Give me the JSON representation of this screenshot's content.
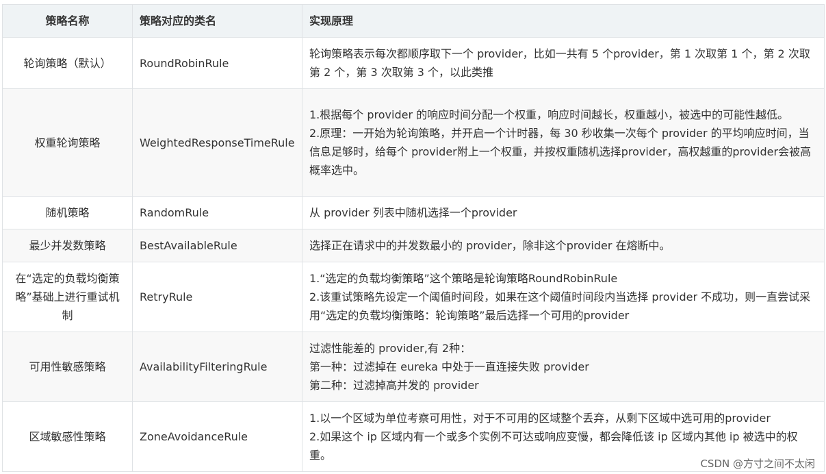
{
  "headers": [
    "策略名称",
    "策略对应的类名",
    "实现原理"
  ],
  "rows": [
    {
      "name": [
        "轮询策略（默认）"
      ],
      "class": "RoundRobinRule",
      "desc": [
        "轮询策略表示每次都顺序取下一个 provider，比如一共有 5 个provider，第 1 次取第 1 个，第 2 次取第 2 个，第 3 次取第 3 个，以此类推"
      ]
    },
    {
      "name": [
        "权重轮询策略"
      ],
      "class": "WeightedResponseTimeRule",
      "desc": [
        "1.根据每个 provider 的响应时间分配一个权重，响应时间越长，权重越小，被选中的可能性越低。",
        "2.原理：一开始为轮询策略，并开启一个计时器，每 30 秒收集一次每个 provider 的平均响应时间，当信息足够时，给每个 provider附上一个权重，并按权重随机选择provider，高权越重的provider会被高概率选中。"
      ]
    },
    {
      "name": [
        "随机策略"
      ],
      "class": "RandomRule",
      "desc": [
        "从 provider 列表中随机选择一个provider"
      ]
    },
    {
      "name": [
        "最少并发数策略"
      ],
      "class": "BestAvailableRule",
      "desc": [
        "选择正在请求中的并发数最小的 provider，除非这个provider 在熔断中。"
      ]
    },
    {
      "name": [
        "在“选定的负载均衡策",
        "略”基础上进行重试机",
        "制"
      ],
      "class": "RetryRule",
      "desc": [
        "1.“选定的负载均衡策略”这个策略是轮询策略RoundRobinRule",
        "2.该重试策略先设定一个阈值时间段，如果在这个阈值时间段内当选择 provider 不成功，则一直尝试采用“选定的负载均衡策略：轮询策略”最后选择一个可用的provider"
      ]
    },
    {
      "name": [
        "可用性敏感策略"
      ],
      "class": "AvailabilityFilteringRule",
      "desc": [
        "过滤性能差的 provider,有 2种：",
        "第一种：过滤掉在 eureka 中处于一直连接失败 provider",
        "第二种：过滤掉高并发的 provider"
      ]
    },
    {
      "name": [
        "区域敏感性策略"
      ],
      "class": "ZoneAvoidanceRule",
      "desc": [
        "1.以一个区域为单位考察可用性，对于不可用的区域整个丢弃，从剩下区域中选可用的provider",
        "2.如果这个 ip 区域内有一个或多个实例不可达或响应变慢，都会降低该 ip 区域内其他 ip 被选中的权重。"
      ]
    }
  ],
  "watermark": "CSDN @方寸之间不太闲"
}
